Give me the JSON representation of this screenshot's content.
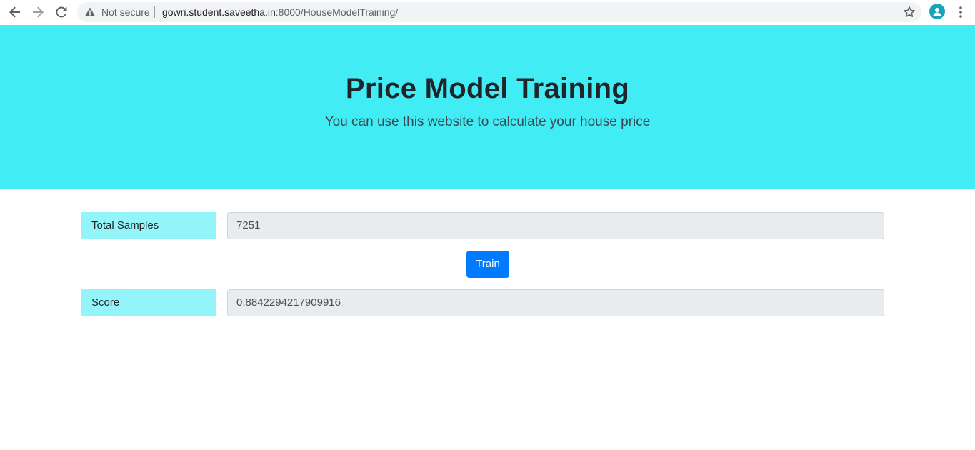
{
  "browser": {
    "security_label": "Not secure",
    "url_host": "gowri.student.saveetha.in",
    "url_rest": ":8000/HouseModelTraining/"
  },
  "hero": {
    "title": "Price Model Training",
    "subtitle": "You can use this website to calculate your house price"
  },
  "form": {
    "samples_label": "Total Samples",
    "samples_value": "7251",
    "train_label": "Train",
    "score_label": "Score",
    "score_value": "0.8842294217909916"
  },
  "colors": {
    "hero_bg": "#41ecf5",
    "label_bg": "#93f5f9",
    "button": "#007bff"
  },
  "icons": [
    "back-arrow-icon",
    "forward-arrow-icon",
    "reload-icon",
    "warning-icon",
    "star-icon",
    "profile-avatar-icon",
    "more-menu-icon"
  ]
}
